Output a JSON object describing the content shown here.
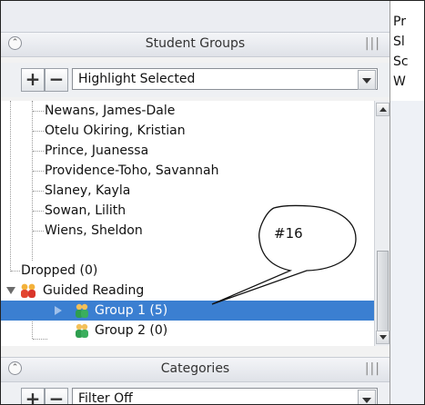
{
  "right_panel": {
    "lines": [
      "Pr",
      "Sl",
      "Sc",
      "W"
    ]
  },
  "student_groups": {
    "title": "Student Groups",
    "collapse_glyph": "⌃",
    "grip_glyph": "|||",
    "add_label": "+",
    "remove_label": "−",
    "dropdown_value": "Highlight Selected",
    "tree": [
      {
        "label": "Newans, James-Dale",
        "type": "student"
      },
      {
        "label": "Otelu Okiring, Kristian",
        "type": "student"
      },
      {
        "label": "Prince, Juanessa",
        "type": "student"
      },
      {
        "label": "Providence-Toho, Savannah",
        "type": "student"
      },
      {
        "label": "Slaney, Kayla",
        "type": "student"
      },
      {
        "label": "Sowan, Lilith",
        "type": "student"
      },
      {
        "label": "Wiens, Sheldon",
        "type": "student"
      },
      {
        "label": "Dropped (0)",
        "type": "folder"
      },
      {
        "label": "Guided Reading",
        "type": "group-parent",
        "expanded": true
      },
      {
        "label": "Group 1 (5)",
        "type": "group",
        "selected": true
      },
      {
        "label": "Group 2 (0)",
        "type": "group"
      }
    ]
  },
  "categories": {
    "title": "Categories",
    "collapse_glyph": "⌃",
    "grip_glyph": "|||",
    "add_label": "+",
    "remove_label": "−",
    "dropdown_value": "Filter Off"
  },
  "callout": {
    "text": "#16"
  },
  "colors": {
    "selection": "#3b7fd1",
    "group_icon_red": "#e2452f",
    "group_icon_green": "#2e9e4f"
  }
}
